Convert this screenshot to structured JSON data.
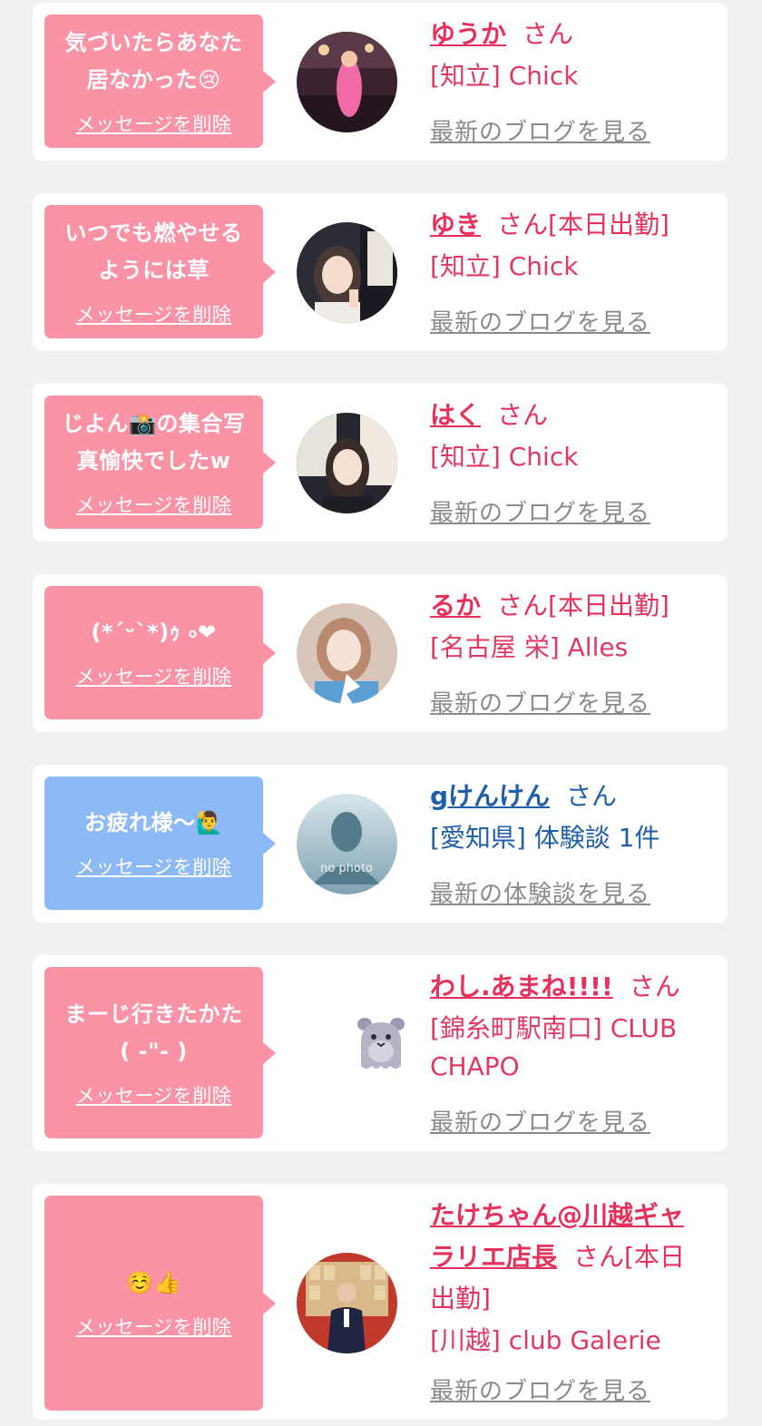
{
  "cards": [
    {
      "message": "気づいたらあなた\n居なかった😢",
      "delete_label": "メッセージを削除",
      "name": "ゆうか",
      "san": "さん",
      "meta": "[知立] Chick",
      "link": "最新のブログを見る",
      "theme": "pink",
      "avatar": "photo-stage"
    },
    {
      "message": "いつでも燃やせる\nようには草",
      "delete_label": "メッセージを削除",
      "name": "ゆき",
      "san": "さん[本日出勤]",
      "meta": "[知立] Chick",
      "link": "最新のブログを見る",
      "theme": "pink",
      "avatar": "photo-peace"
    },
    {
      "message": "じよん📸の集合写\n真愉快でしたw",
      "delete_label": "メッセージを削除",
      "name": "はく",
      "san": "さん",
      "meta": "[知立] Chick",
      "link": "最新のブログを見る",
      "theme": "pink",
      "avatar": "photo-poster"
    },
    {
      "message": "(*´ᵕ`*)ｩ ৹❤",
      "delete_label": "メッセージを削除",
      "name": "るか",
      "san": "さん[本日出勤]",
      "meta": "[名古屋 栄] Alles",
      "link": "最新のブログを見る",
      "theme": "pink",
      "avatar": "photo-blue-outfit"
    },
    {
      "message": "お疲れ様〜🙋‍♂️",
      "delete_label": "メッセージを削除",
      "name": "gけんけん",
      "san": "さん",
      "meta": "[愛知県] 体験談 1件",
      "link": "最新の体験談を見る",
      "theme": "blue",
      "avatar": "no-photo",
      "avatar_text": "no photo"
    },
    {
      "message": "まーじ行きたかた\n( -\"- )",
      "delete_label": "メッセージを削除",
      "name": "わし.あまね!!!!",
      "san": "さん",
      "meta": "[錦糸町駅南口] CLUB\nCHAPO",
      "link": "最新のブログを見る",
      "theme": "pink",
      "avatar": "ghost-mascot"
    },
    {
      "message": "☺️👍",
      "delete_label": "メッセージを削除",
      "name": "たけちゃん@川越ギャラリエ店長",
      "san": "さん[本日出勤]",
      "meta": "[川越] club Galerie",
      "link": "最新のブログを見る",
      "theme": "pink",
      "avatar": "photo-suit"
    }
  ],
  "colors": {
    "pink_bubble": "#fb93a6",
    "blue_bubble": "#8db9f7",
    "pink_name": "#e5315b",
    "blue_name": "#1f5fa9",
    "link_gray": "#8a8a8a",
    "background": "#f1f1f3"
  }
}
